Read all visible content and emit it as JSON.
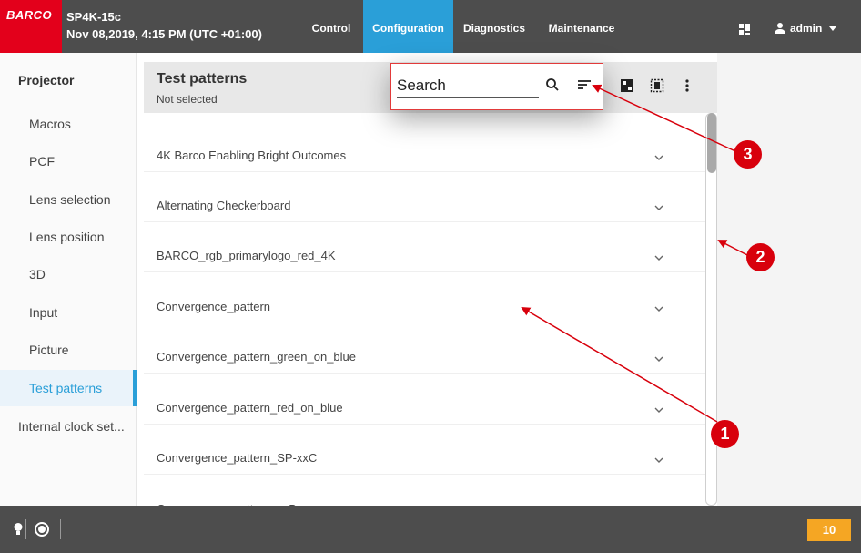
{
  "header": {
    "logo": "BARCO",
    "device_name": "SP4K-15c",
    "datetime": "Nov 08,2019, 4:15 PM (UTC +01:00)",
    "tabs": [
      {
        "label": "Control",
        "active": false
      },
      {
        "label": "Configuration",
        "active": true
      },
      {
        "label": "Diagnostics",
        "active": false
      },
      {
        "label": "Maintenance",
        "active": false
      }
    ],
    "user": "admin",
    "accent_color": "#2a9fd8",
    "brand_color": "#e3001b"
  },
  "sidebar": {
    "title": "Projector",
    "items": [
      {
        "label": "Macros",
        "active": false
      },
      {
        "label": "PCF",
        "active": false
      },
      {
        "label": "Lens selection",
        "active": false
      },
      {
        "label": "Lens position",
        "active": false
      },
      {
        "label": "3D",
        "active": false
      },
      {
        "label": "Input",
        "active": false
      },
      {
        "label": "Picture",
        "active": false
      },
      {
        "label": "Test patterns",
        "active": true
      },
      {
        "label": "Internal clock set..."
      }
    ]
  },
  "panel": {
    "title": "Test patterns",
    "subtitle": "Not selected",
    "search_placeholder": "Search",
    "toolbar_icons": [
      "search-icon",
      "sort-icon",
      "checkerboard-icon",
      "fit-screen-icon",
      "more-vert-icon"
    ]
  },
  "patterns": [
    "4K Barco Enabling Bright Outcomes",
    "Alternating Checkerboard",
    "BARCO_rgb_primarylogo_red_4K",
    "Convergence_pattern",
    "Convergence_pattern_green_on_blue",
    "Convergence_pattern_red_on_blue",
    "Convergence_pattern_SP-xxC",
    "Convergence_pattern_xxB"
  ],
  "footer": {
    "notification_count": "10",
    "notification_color": "#f5a623"
  },
  "callouts": [
    "1",
    "2",
    "3"
  ],
  "callout_color": "#d8000c"
}
